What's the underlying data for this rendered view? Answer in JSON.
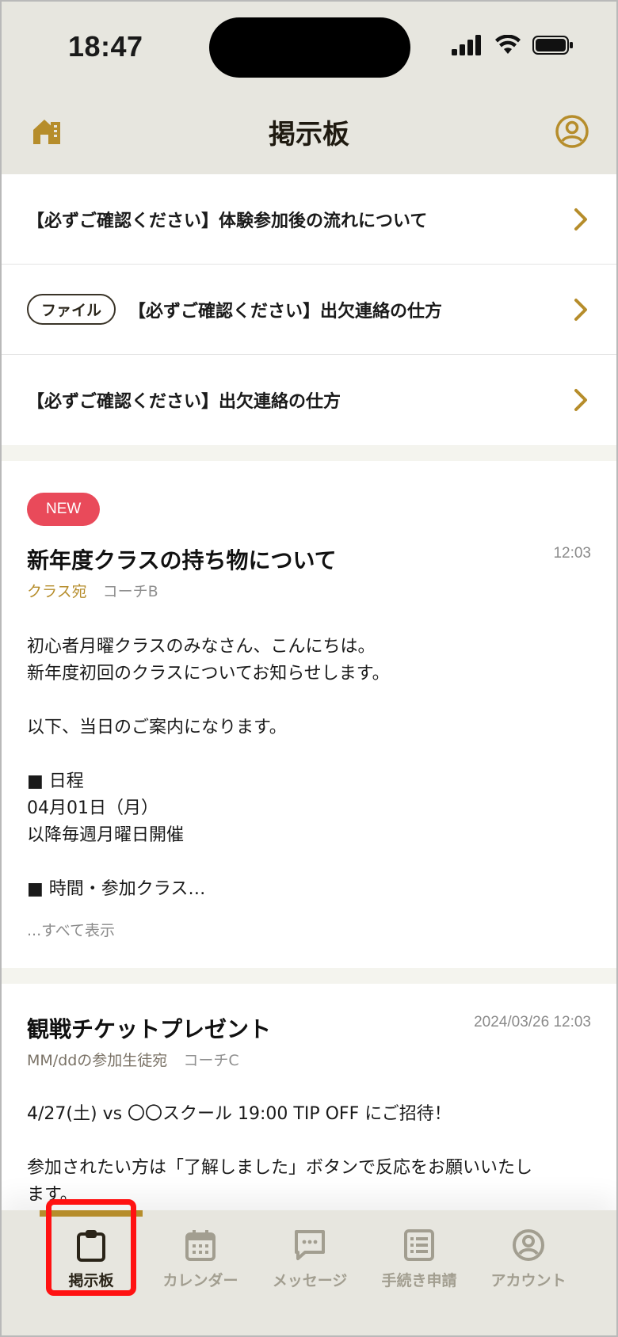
{
  "status_bar": {
    "time": "18:47"
  },
  "header": {
    "title": "掲示板",
    "home_icon": "home-icon",
    "account_icon": "account-circle-icon"
  },
  "pinned": [
    {
      "text": "【必ずご確認ください】体験参加後の流れについて",
      "tag": ""
    },
    {
      "text": "【必ずご確認ください】出欠連絡の仕方",
      "tag": "ファイル"
    },
    {
      "text": "【必ずご確認ください】出欠連絡の仕方",
      "tag": ""
    }
  ],
  "posts": [
    {
      "badge": "NEW",
      "title": "新年度クラスの持ち物について",
      "time": "12:03",
      "audience": "クラス宛",
      "author": "コーチB",
      "lines": [
        "初心者月曜クラスのみなさん、こんにちは。",
        "新年度初回のクラスについてお知らせします。",
        "",
        "以下、当日のご案内になります。",
        "",
        "■ 日程",
        "04月01日（月）",
        "以降毎週月曜日開催",
        "",
        "■ 時間・参加クラス…"
      ],
      "show_all": "...すべて表示"
    },
    {
      "title": "観戦チケットプレゼント",
      "time": "2024/03/26  12:03",
      "audience": "MM/ddの参加生徒宛",
      "author": "コーチC",
      "lines": [
        "4/27(土) vs 〇〇スクール 19:00 TIP OFF  にご招待！",
        "",
        "参加されたい方は「了解しました」ボタンで反応をお願いいたし",
        "ます。"
      ]
    }
  ],
  "tabs": [
    {
      "label": "掲示板",
      "icon": "clipboard-icon",
      "active": true
    },
    {
      "label": "カレンダー",
      "icon": "calendar-icon",
      "active": false
    },
    {
      "label": "メッセージ",
      "icon": "message-icon",
      "active": false
    },
    {
      "label": "手続き申請",
      "icon": "form-list-icon",
      "active": false
    },
    {
      "label": "アカウント",
      "icon": "account-circle-icon",
      "active": false
    }
  ],
  "colors": {
    "accent": "#b68d2b",
    "new_badge": "#e94a5a",
    "header_bg": "#e7e6df",
    "highlight": "#ff1212"
  }
}
